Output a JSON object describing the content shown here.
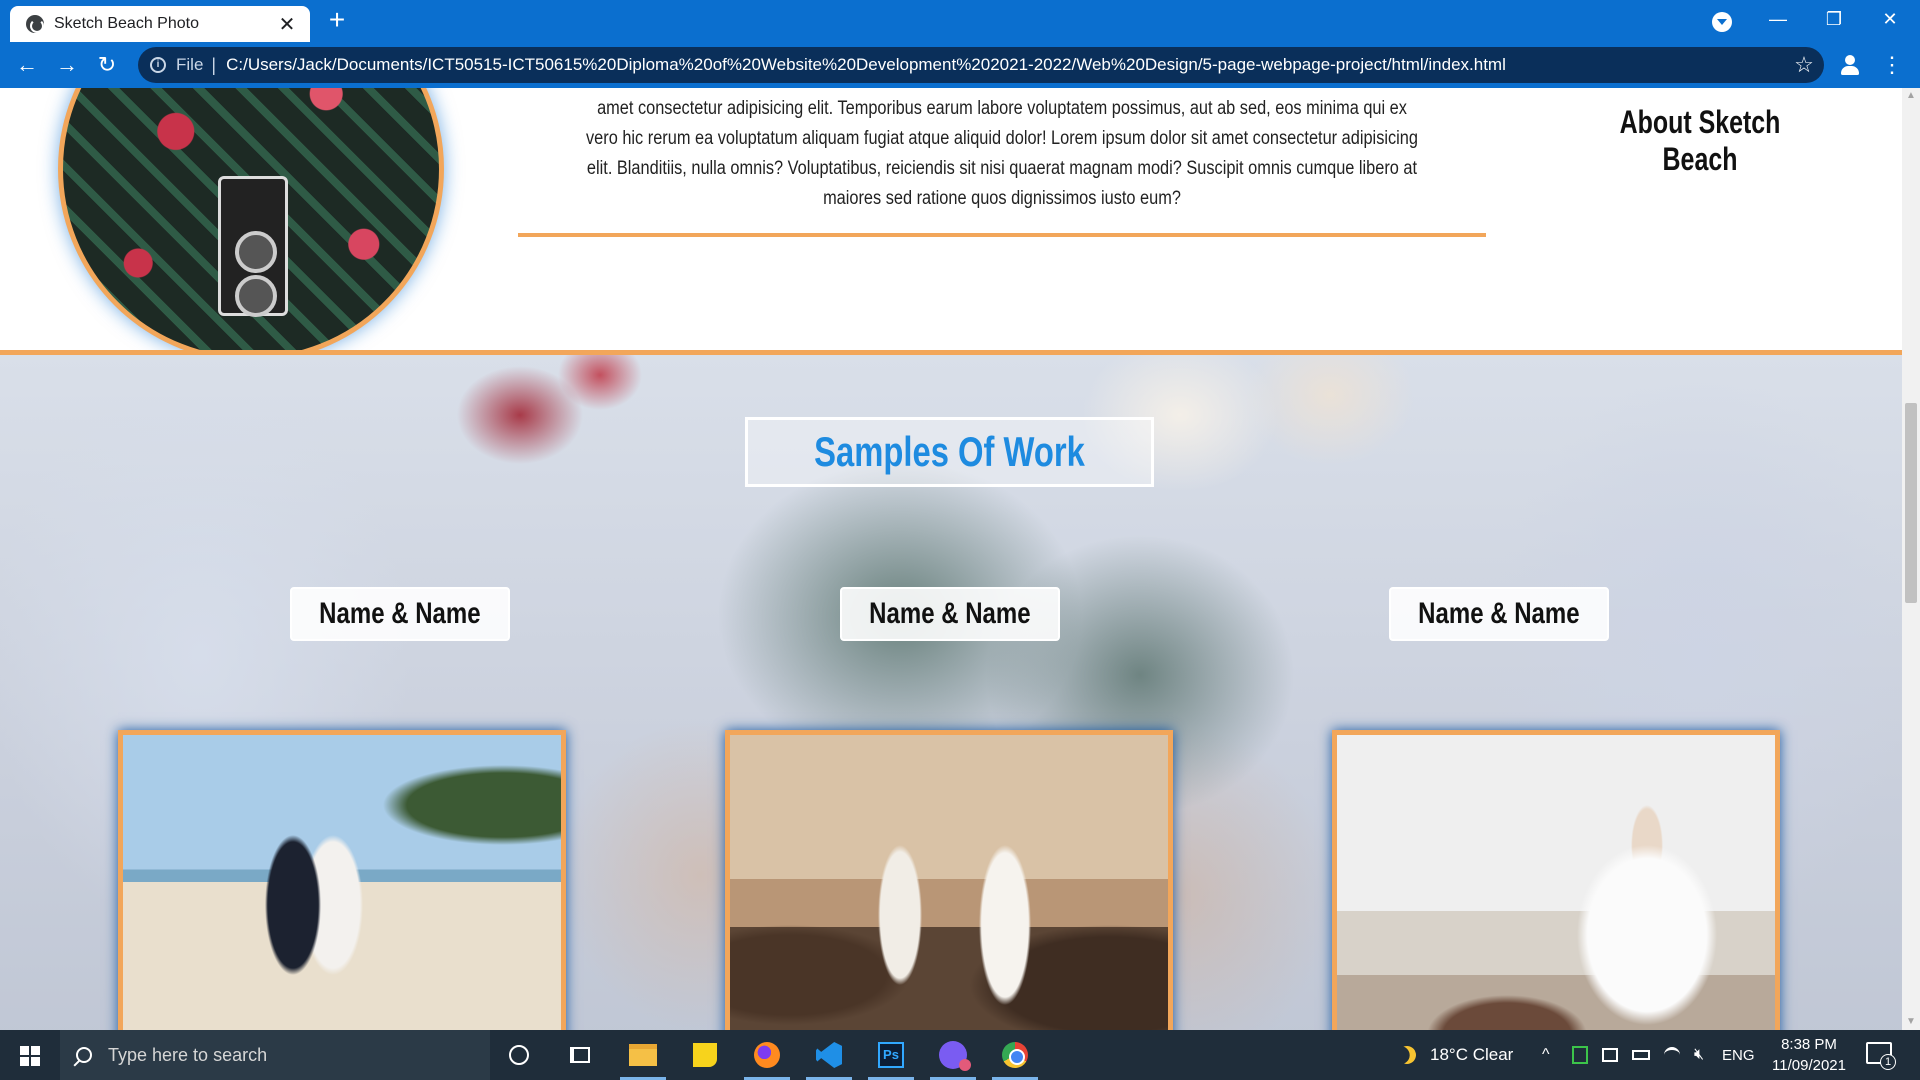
{
  "browser": {
    "tab_title": "Sketch Beach Photo",
    "tab_close": "✕",
    "new_tab": "+",
    "minimize": "—",
    "restore": "❐",
    "close": "✕",
    "file_label": "File",
    "separator": "|",
    "url": "C:/Users/Jack/Documents/ICT50515-ICT50615%20Diploma%20of%20Website%20Development%202021-2022/Web%20Design/5-page-webpage-project/html/index.html",
    "star": "☆",
    "back": "←",
    "forward": "→",
    "reload": "↻",
    "menu": "⋮"
  },
  "about": {
    "text": "amet consectetur adipisicing elit. Temporibus earum labore voluptatem possimus, aut ab sed, eos minima qui ex vero hic rerum ea voluptatum aliquam fugiat atque aliquid dolor! Lorem ipsum dolor sit amet consectetur adipisicing elit. Blanditiis, nulla omnis? Voluptatibus, reiciendis sit nisi quaerat magnam modi? Suscipit omnis cumque libero at maiores sed ratione quos dignissimos iusto eum?",
    "heading": "About Sketch Beach"
  },
  "samples": {
    "title": "Samples Of Work",
    "cards": [
      {
        "name": "Name & Name",
        "photo": "couple-kissing-on-beach"
      },
      {
        "name": "Name & Name",
        "photo": "couple-holding-hands-at-sunset"
      },
      {
        "name": "Name & Name",
        "photo": "bride-with-arms-outstretched"
      }
    ]
  },
  "taskbar": {
    "search_placeholder": "Type here to search",
    "apps": [
      "cortana-icon",
      "task-view-icon",
      "file-explorer-icon",
      "sticky-notes-icon",
      "firefox-icon",
      "vscode-icon",
      "photoshop-icon",
      "discord-icon",
      "chrome-icon"
    ],
    "ps_label": "Ps",
    "weather": "18°C  Clear",
    "tray_chevron": "^",
    "language": "ENG",
    "time": "8:38 PM",
    "date": "11/09/2021",
    "notification_count": "1"
  },
  "colors": {
    "accent_orange": "#f2a65a",
    "title_blue": "#1e8be0",
    "chrome_blue": "#0b6fcf"
  }
}
